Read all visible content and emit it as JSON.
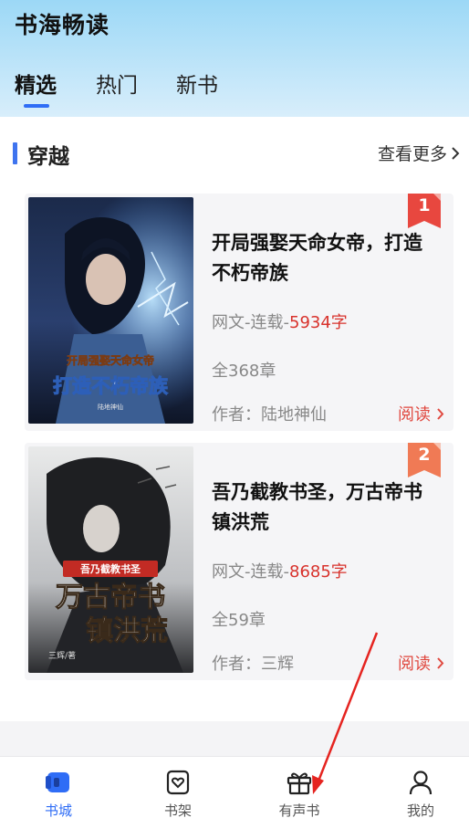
{
  "app": {
    "title": "书海畅读"
  },
  "tabs": [
    {
      "label": "精选",
      "active": true
    },
    {
      "label": "热门",
      "active": false
    },
    {
      "label": "新书",
      "active": false
    }
  ],
  "section": {
    "title": "穿越",
    "more_label": "查看更多"
  },
  "books": [
    {
      "rank": "1",
      "title": "开局强娶天命女帝，打造不朽帝族",
      "category": "网文-连载-",
      "word_count": "5934字",
      "chapters": "全368章",
      "author": "作者：陆地神仙",
      "read_label": "阅读",
      "cover_title_top": "开局强娶天命女帝",
      "cover_title_main": "打造不朽帝族",
      "cover_author": "陆地神仙"
    },
    {
      "rank": "2",
      "title": "吾乃截教书圣，万古帝书镇洪荒",
      "category": "网文-连载-",
      "word_count": "8685字",
      "chapters": "全59章",
      "author": "作者：三辉",
      "read_label": "阅读",
      "cover_title_top": "吾乃截教书圣",
      "cover_title_main_1": "万古帝书",
      "cover_title_main_2": "镇洪荒",
      "cover_author": "三辉/著"
    }
  ],
  "bottom_nav": [
    {
      "label": "书城",
      "icon": "book-city-icon",
      "active": true
    },
    {
      "label": "书架",
      "icon": "bookshelf-icon",
      "active": false
    },
    {
      "label": "有声书",
      "icon": "gift-icon",
      "active": false
    },
    {
      "label": "我的",
      "icon": "person-icon",
      "active": false
    }
  ],
  "colors": {
    "accent": "#2f6df6",
    "rank_1": "#e8473f",
    "rank_2": "#f07a55",
    "word_count": "#d8322c",
    "read": "#e0483f",
    "annotation_arrow": "#e52420"
  }
}
